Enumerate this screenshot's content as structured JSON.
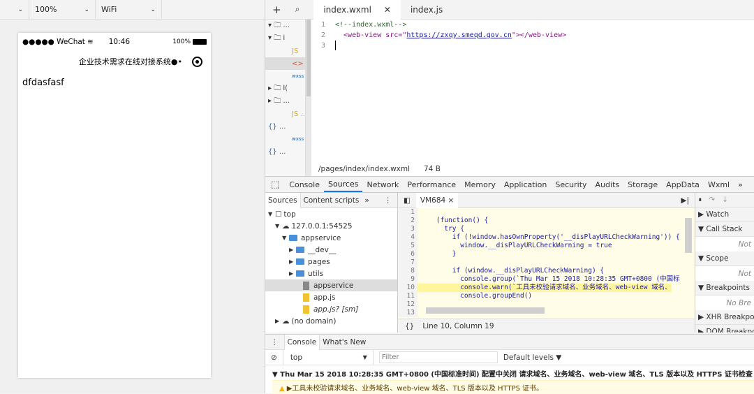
{
  "simulator": {
    "selects": [
      "",
      "100%",
      "WiFi"
    ],
    "status": {
      "carrier": "●●●●● WeChat",
      "time": "10:46",
      "battery": "100%"
    },
    "nav_title": "企业技术需求在线对接系统",
    "nav_dots": "●•",
    "body_text": "dfdasfasf"
  },
  "editor": {
    "tabs": [
      "index.wxml",
      "index.js"
    ],
    "tree": [
      {
        "label": "▾ 🗀 ...",
        "type": "folder"
      },
      {
        "label": "▾ 🗀 i",
        "type": "folder"
      },
      {
        "label": "JS",
        "type": "js"
      },
      {
        "label": "<>",
        "type": "wxml"
      },
      {
        "label": "wxss",
        "type": "wxss"
      },
      {
        "label": "▸ 🗀 l(",
        "type": "folder"
      },
      {
        "label": "▸ 🗀 ...",
        "type": "folder"
      },
      {
        "label": "JS ...",
        "type": "js"
      },
      {
        "label": "{} ...",
        "type": "json"
      },
      {
        "label": "wxss ...",
        "type": "wxss"
      },
      {
        "label": "{} ...",
        "type": "json"
      }
    ],
    "code": [
      {
        "n": "1",
        "text": "<!--index.wxml-->"
      },
      {
        "n": "2",
        "pre": "  <web-view src=\"",
        "url": "https://zxqy.smeqd.gov.cn",
        "post": "\"></web-view>"
      },
      {
        "n": "3",
        "text": ""
      }
    ],
    "path": "/pages/index/index.wxml",
    "size": "74 B"
  },
  "devtools": {
    "tabs": [
      "Console",
      "Sources",
      "Network",
      "Performance",
      "Memory",
      "Application",
      "Security",
      "Audits",
      "Storage",
      "AppData",
      "Wxml",
      "»"
    ],
    "active_tab": "Sources",
    "source_tabs": [
      "Sources",
      "Content scripts",
      "»"
    ],
    "tree": [
      {
        "label": "top",
        "indent": 4,
        "arrow": "▼",
        "icon": "frame"
      },
      {
        "label": "127.0.0.1:54525",
        "indent": 14,
        "arrow": "▼",
        "icon": "cloud"
      },
      {
        "label": "appservice",
        "indent": 24,
        "arrow": "▼",
        "icon": "folder"
      },
      {
        "label": "__dev__",
        "indent": 34,
        "arrow": "▶",
        "icon": "folder"
      },
      {
        "label": "pages",
        "indent": 34,
        "arrow": "▶",
        "icon": "folder"
      },
      {
        "label": "utils",
        "indent": 34,
        "arrow": "▶",
        "icon": "folder"
      },
      {
        "label": "appservice",
        "indent": 44,
        "arrow": "",
        "icon": "file-gray",
        "selected": true
      },
      {
        "label": "app.js",
        "indent": 44,
        "arrow": "",
        "icon": "file-yellow"
      },
      {
        "label": "app.js? [sm]",
        "indent": 44,
        "arrow": "",
        "icon": "file-yellow",
        "italic": true
      },
      {
        "label": "(no domain)",
        "indent": 14,
        "arrow": "▶",
        "icon": "cloud"
      }
    ],
    "vm_tab": "VM684 ×",
    "vm_code": [
      {
        "n": "1",
        "t": ""
      },
      {
        "n": "2",
        "t": "    (function() {"
      },
      {
        "n": "3",
        "t": "      try {"
      },
      {
        "n": "4",
        "t": "        if (!window.hasOwnProperty('__disPlayURLCheckWarning')) {"
      },
      {
        "n": "5",
        "t": "          window.__disPlayURLCheckWarning = true"
      },
      {
        "n": "6",
        "t": "        }"
      },
      {
        "n": "7",
        "t": ""
      },
      {
        "n": "8",
        "t": "        if (window.__disPlayURLCheckWarning) {"
      },
      {
        "n": "9",
        "t": "          console.group(`Thu Mar 15 2018 10:28:35 GMT+0800 (中国标"
      },
      {
        "n": "10",
        "t": "          console.warn(`工具未校验请求域名、业务域名、web-view 域名、",
        "hl": true
      },
      {
        "n": "11",
        "t": "          console.groupEnd()"
      },
      {
        "n": "12",
        "t": ""
      },
      {
        "n": "13",
        "t": ""
      }
    ],
    "vm_footer": "Line 10, Column 19",
    "debugger": [
      {
        "label": "▶ Watch"
      },
      {
        "label": "▼ Call Stack",
        "empty": "Not"
      },
      {
        "label": "▼ Scope",
        "empty": "Not"
      },
      {
        "label": "▼ Breakpoints",
        "empty": "No Bre"
      },
      {
        "label": "▶ XHR Breakpoint"
      },
      {
        "label": "▶ DOM Breakpoint"
      }
    ]
  },
  "console": {
    "tabs": [
      "Console",
      "What's New"
    ],
    "context": "top",
    "filter_placeholder": "Filter",
    "levels": "Default levels ▼",
    "group_msg": "▼ Thu Mar 15 2018 10:28:35 GMT+0800 (中国标准时间) 配置中关闭 请求域名、业务域名、web-view 域名、TLS 版本以及 HTTPS 证书检查",
    "warn_msg": "▶工具未校验请求域名、业务域名、web-view 域名、TLS 版本以及 HTTPS 证书。"
  }
}
